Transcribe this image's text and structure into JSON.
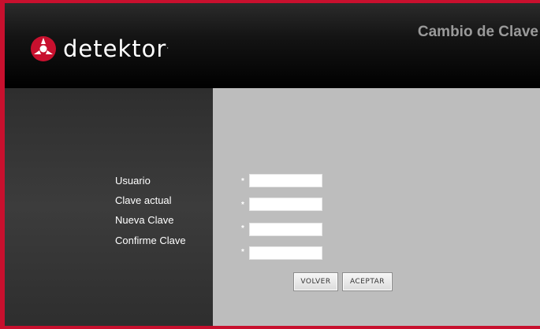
{
  "brand": {
    "name": "detektor",
    "trademark": "."
  },
  "header": {
    "title": "Cambio de Clave"
  },
  "colors": {
    "frame": "#c8102e",
    "logo_mark": "#c8102e",
    "content_bg": "#bdbdbd",
    "sidebar_bg": "#353535"
  },
  "form": {
    "fields": [
      {
        "label": "Usuario",
        "required_mark": "*",
        "value": ""
      },
      {
        "label": "Clave actual",
        "required_mark": "*",
        "value": ""
      },
      {
        "label": "Nueva Clave",
        "required_mark": "*",
        "value": ""
      },
      {
        "label": "Confirme Clave",
        "required_mark": "*",
        "value": ""
      }
    ],
    "buttons": {
      "back": "VOLVER",
      "accept": "ACEPTAR"
    }
  }
}
